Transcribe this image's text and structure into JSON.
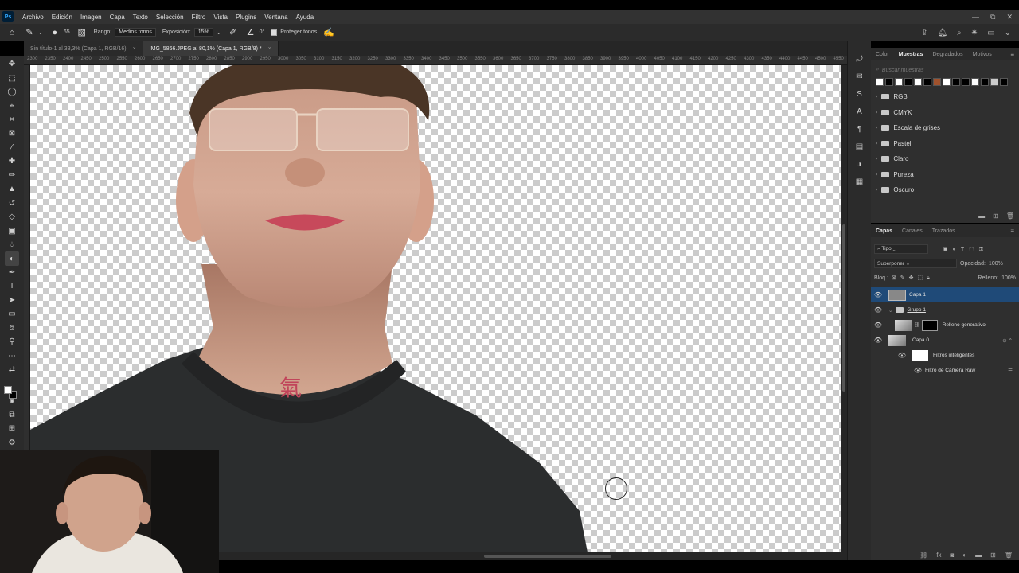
{
  "app": {
    "logo": "Ps"
  },
  "menu": [
    "Archivo",
    "Edición",
    "Imagen",
    "Capa",
    "Texto",
    "Selección",
    "Filtro",
    "Vista",
    "Plugins",
    "Ventana",
    "Ayuda"
  ],
  "window_controls": {
    "minimize": "—",
    "restore": "⧉",
    "close": "✕"
  },
  "options": {
    "brush_size": "65",
    "range_label": "Rango:",
    "range_value": "Medios tonos",
    "exposure_label": "Exposición:",
    "exposure_value": "15%",
    "angle_value": "0°",
    "protect_label": "Proteger tonos",
    "protect_checked": true
  },
  "tabs": [
    {
      "label": "Sin título-1 al 33,3% (Capa 1, RGB/16)",
      "close": "×"
    },
    {
      "label": "IMG_5866.JPEG al 80,1% (Capa 1, RGB/8) *",
      "close": "×"
    }
  ],
  "ruler": [
    "2300",
    "2350",
    "2400",
    "2450",
    "2500",
    "2550",
    "2600",
    "2650",
    "2700",
    "2750",
    "2800",
    "2850",
    "2900",
    "2950",
    "3000",
    "3050",
    "3100",
    "3150",
    "3200",
    "3250",
    "3300",
    "3350",
    "3400",
    "3450",
    "3500",
    "3550",
    "3600",
    "3650",
    "3700",
    "3750",
    "3800",
    "3850",
    "3900",
    "3950",
    "4000",
    "4050",
    "4100",
    "4150",
    "4200",
    "4250",
    "4300",
    "4350",
    "4400",
    "4450",
    "4500",
    "4550"
  ],
  "swatches_panel": {
    "tabs": [
      "Color",
      "Muestras",
      "Degradados",
      "Motivos"
    ],
    "active_tab": "Muestras",
    "search_placeholder": "Buscar muestras",
    "recent_colors": [
      "#ffffff",
      "#000000",
      "#ffffff",
      "#000000",
      "#ffffff",
      "#000000",
      "#a0522d",
      "#ffffff",
      "#000000",
      "#000000",
      "#ffffff",
      "#000000",
      "#cccccc",
      "#000000"
    ],
    "folders": [
      "RGB",
      "CMYK",
      "Escala de grises",
      "Pastel",
      "Claro",
      "Pureza",
      "Oscuro"
    ]
  },
  "layers_panel": {
    "tabs": [
      "Capas",
      "Canales",
      "Trazados"
    ],
    "active_tab": "Capas",
    "filter_label": "Tipo",
    "blend_mode": "Superponer",
    "opacity_label": "Opacidad:",
    "opacity_value": "100%",
    "lock_label": "Bloq.:",
    "fill_label": "Relleno:",
    "fill_value": "100%",
    "layers": [
      {
        "name": "Capa 1",
        "selected": true
      },
      {
        "name": "Grupo 1"
      },
      {
        "name": "Relleno generativo"
      },
      {
        "name": "Capa 0"
      },
      {
        "name": "Filtros inteligentes"
      },
      {
        "name": "Filtro de Camera Raw"
      }
    ]
  },
  "colors": {
    "accent": "#1f4a78",
    "panel": "#2f2f2f",
    "chrome": "#323232"
  }
}
